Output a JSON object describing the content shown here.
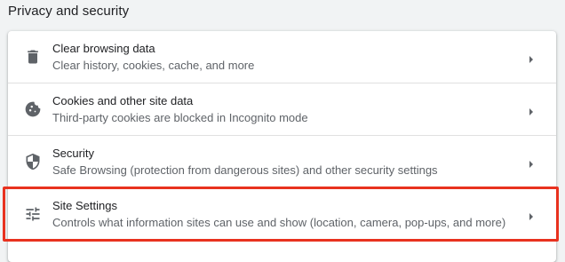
{
  "section": {
    "title": "Privacy and security"
  },
  "items": [
    {
      "title": "Clear browsing data",
      "subtitle": "Clear history, cookies, cache, and more",
      "icon": "trash-icon"
    },
    {
      "title": "Cookies and other site data",
      "subtitle": "Third-party cookies are blocked in Incognito mode",
      "icon": "cookie-icon"
    },
    {
      "title": "Security",
      "subtitle": "Safe Browsing (protection from dangerous sites) and other security settings",
      "icon": "shield-icon"
    },
    {
      "title": "Site Settings",
      "subtitle": "Controls what information sites can use and show (location, camera, pop-ups, and more)",
      "icon": "sliders-icon",
      "highlighted": true
    }
  ],
  "colors": {
    "highlight": "#e8321f",
    "icon": "#5f6368",
    "card": "#ffffff",
    "background": "#f1f3f4"
  }
}
